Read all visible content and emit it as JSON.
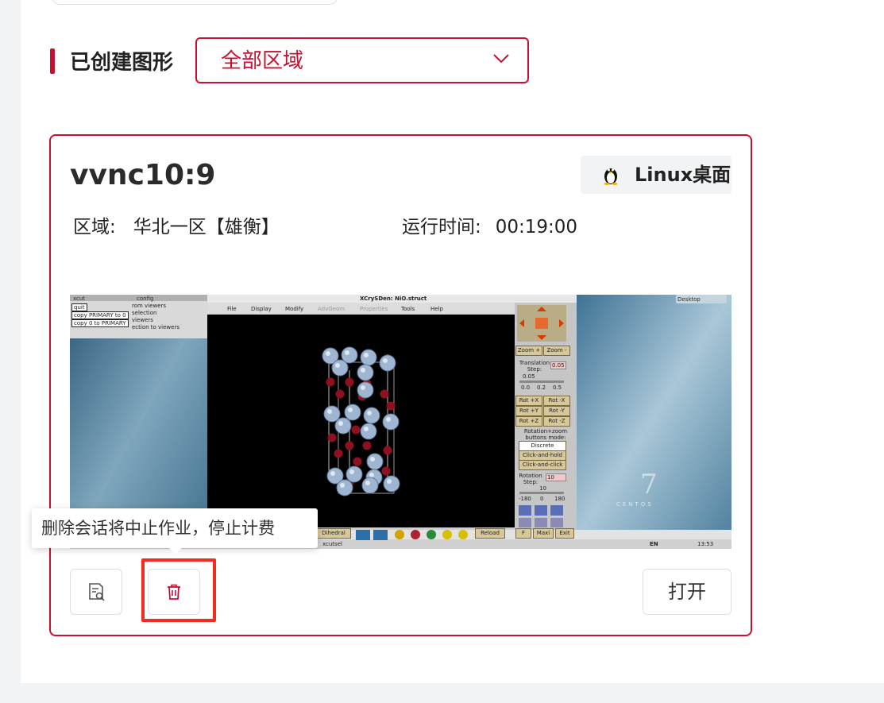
{
  "section": {
    "title": "已创建图形"
  },
  "region_filter": {
    "value": "全部区域"
  },
  "session": {
    "name": "vvnc10:9",
    "os_label": "Linux桌面",
    "region_label": "区域:",
    "region_value": "华北一区【雄衡】",
    "runtime_label": "运行时间:",
    "runtime_value": "00:19:00"
  },
  "tooltip": {
    "text": "删除会话将中止作业，停止计费"
  },
  "actions": {
    "open_label": "打开"
  },
  "preview": {
    "window_title": "XCrySDen: NiO.struct",
    "menu": [
      "File",
      "Display",
      "Modify",
      "AdvGeom",
      "Properties",
      "Tools",
      "Help"
    ],
    "left_buttons": [
      "quit",
      "copy PRIMARY to 0",
      "copy 0 to PRIMARY"
    ],
    "left_lines": [
      "rom viewers",
      "selection",
      "viewers",
      "ection to viewers"
    ],
    "small_title_a": "xcut",
    "small_title_b": "config",
    "desktop_label": "Desktop",
    "zoom_in": "Zoom +",
    "zoom_out": "Zoom -",
    "translation_label": "Translation Step:",
    "translation_value": "0.05",
    "slider_ticks_a": [
      "0.0",
      "0.2",
      "0.5"
    ],
    "slider_value_a": "0.05",
    "rot_buttons": [
      "Rot +X",
      "Rot -X",
      "Rot +Y",
      "Rot -Y",
      "Rot +Z",
      "Rot -Z"
    ],
    "rotation_mode_label": "Rotation+zoom buttons mode:",
    "modes": [
      "Discrete",
      "Click-and-hold",
      "Click-and-click"
    ],
    "rotation_step_label": "Rotation Step:",
    "rotation_step_value": "10",
    "slider_ticks_b": [
      "-180",
      "0",
      "180"
    ],
    "slider_value_b": "10",
    "bottom_buttons": [
      "Dihedral",
      "Reload",
      "F",
      "Maxi",
      "Exit"
    ],
    "taskbar_item": "xcutsel",
    "tray_lang": "EN",
    "tray_clock": "13:53",
    "centos_number": "7",
    "centos_text": "CENTOS"
  }
}
